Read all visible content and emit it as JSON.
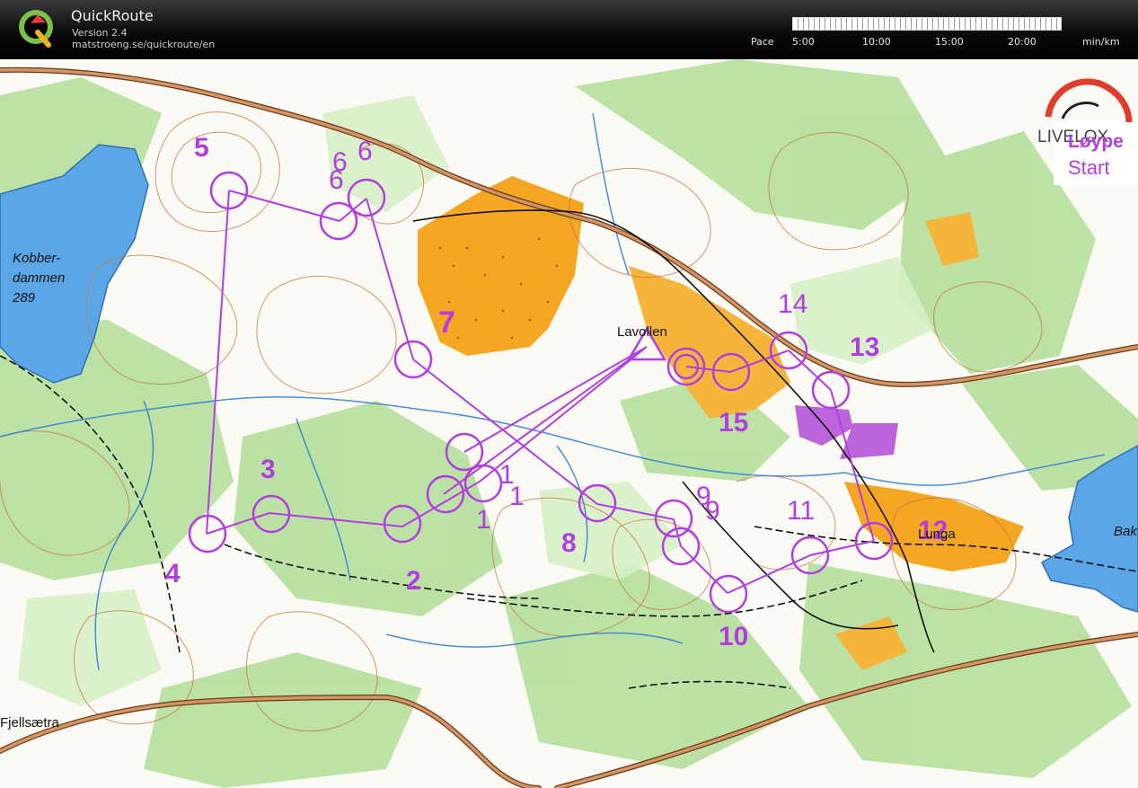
{
  "app": {
    "title": "QuickRoute",
    "version": "Version 2.4",
    "url": "matstroeng.se/quickroute/en"
  },
  "pace": {
    "label": "Pace",
    "ticks": [
      "5:00",
      "10:00",
      "15:00",
      "20:00"
    ],
    "unit": "min/km"
  },
  "map": {
    "place_names": {
      "lake_name": "Kobber-",
      "lake_name_2": "dammen",
      "lake_height": "289",
      "lavollen": "Lavollen",
      "lunga": "Lunga",
      "fjellsaetra": "Fjellsætra",
      "bak": "Bak"
    },
    "livelox": {
      "brand": "LIVELOX",
      "course_name": "Løype",
      "course_start": "Start"
    },
    "controls": [
      {
        "number": "1"
      },
      {
        "number": "2"
      },
      {
        "number": "3"
      },
      {
        "number": "4"
      },
      {
        "number": "5"
      },
      {
        "number": "6"
      },
      {
        "number": "7"
      },
      {
        "number": "8"
      },
      {
        "number": "9"
      },
      {
        "number": "10"
      },
      {
        "number": "11"
      },
      {
        "number": "12"
      },
      {
        "number": "13"
      },
      {
        "number": "14"
      },
      {
        "number": "15"
      }
    ],
    "colors": {
      "course": "#b23ee0",
      "lake": "#5aa6e6",
      "forest_green": "#a6d98c",
      "open_yellow": "#f5a623",
      "road_brown": "#c8875a",
      "contour": "#c9733a"
    }
  }
}
